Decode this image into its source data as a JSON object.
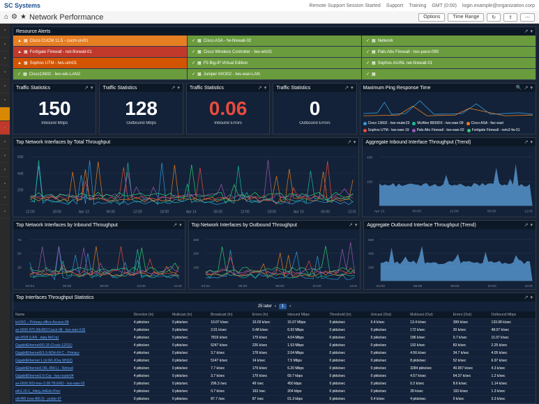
{
  "brand": "SC Systems",
  "topbar": {
    "items": [
      "Remote Support Session Started",
      "Support",
      "Training",
      "GMT (0:00)",
      "login.example@organization.corp"
    ]
  },
  "page_title": "Network Performance",
  "subbar_controls": [
    "Options",
    "Time Range"
  ],
  "sidebar": {
    "count": 14
  },
  "alerts": {
    "title": "Resource Alerts",
    "cells": [
      {
        "cls": "orange",
        "txt": "Cisco CUCM 11.5 - cucm-srv01"
      },
      {
        "cls": "green",
        "txt": "Cisco ASA - fw-firewall-02"
      },
      {
        "cls": "green",
        "txt": "Network"
      },
      {
        "cls": "red",
        "txt": "Fortigate Firewall - net-firewall-01"
      },
      {
        "cls": "green",
        "txt": "Cisco Wireless Controller - lws-wlc01"
      },
      {
        "cls": "green",
        "txt": "Palo Alto Firewall - lws-pano-090"
      },
      {
        "cls": "lightred",
        "txt": "Sophos UTM - lws-utm01"
      },
      {
        "cls": "green",
        "txt": "F5 Big-IP Virtual Edition"
      },
      {
        "cls": "green",
        "txt": "Sophos AU/NL net-firewall-01"
      },
      {
        "cls": "green",
        "txt": "Cisco13602 - lws-wlc-LAN2"
      },
      {
        "cls": "green",
        "txt": "Juniper MX302 - lws-wan-LAN"
      },
      {
        "cls": "green",
        "txt": ""
      }
    ]
  },
  "stats": [
    {
      "title": "Traffic Statistics",
      "value": "150",
      "label": "Inbound Mbps"
    },
    {
      "title": "Traffic Statistics",
      "value": "128",
      "label": "Outbound Mbps"
    },
    {
      "title": "Traffic Statistics",
      "value": "0.06",
      "label": "Inbound Errors",
      "red": true
    },
    {
      "title": "Traffic Statistics",
      "value": "0",
      "label": "Outbound Errors"
    }
  ],
  "charts": {
    "ping": {
      "title": "Maximum Ping Response Time",
      "legend": [
        "Cisco 13602 - lws-router23",
        "McAfee 8500DX - lws-wan-09",
        "Cisco ASA - fwc-east",
        "Sophos UTM - lws-wan-19",
        "Palo Alto Firewall - lws-wan-02",
        "Fortigate Firewall - netv2-fw-01"
      ]
    },
    "top_throughput": {
      "title": "Top Network Interfaces by Total Throughput",
      "ylabels": [
        "600",
        "400",
        "200"
      ],
      "xlabels": [
        "12:00",
        "18:00",
        "Apr 13",
        "06:00",
        "12:00",
        "18:00",
        "Apr 14",
        "06:00",
        "12:00",
        "18:00",
        "Apr 15",
        "06:00",
        "12:00"
      ]
    },
    "inbound": {
      "title": "Top Network Interfaces by Inbound Throughput",
      "ylabels": [
        "75",
        "50",
        "25"
      ],
      "xlabels": [
        "04:04",
        "06:00",
        "08:00",
        "10:00",
        "12:00"
      ]
    },
    "outbound": {
      "title": "Top Network Interfaces by Outbound Throughput",
      "ylabels": [
        "300",
        "200",
        "100"
      ],
      "xlabels": [
        "04:04",
        "06:00",
        "08:00",
        "10:00",
        "12:00"
      ]
    },
    "agg_in": {
      "title": "Aggregate Inbound Interface Throughput (Trend)",
      "ylabels": [
        "400",
        "200"
      ],
      "xlabels": [
        "Apr 13",
        "00:00",
        "12:00",
        "00:00",
        "12:00"
      ]
    },
    "agg_out": {
      "title": "Aggregate Outbound Interface Throughput (Trend)",
      "ylabels": [
        "600",
        "400",
        "200"
      ],
      "xlabels": [
        "04:00",
        "06:00",
        "08:00",
        "10:00",
        "12:00"
      ]
    }
  },
  "table": {
    "title": "Top Interfaces Throughput Statistics",
    "pager": {
      "info": "25 later",
      "page": "1"
    },
    "headers": [
      "Name",
      "Direction (In)",
      "Multicast (In)",
      "Broadcast (In)",
      "Errors (In)",
      "Inbound Mbps",
      "Threshold (In)",
      "Unicast (Out)",
      "Multicast (Out)",
      "Errors (Out)",
      "Outbound Mbps"
    ],
    "rows": [
      [
        "te1/0/1 – Primary-office-Access-08",
        "4 pkts/sec",
        "0 pkts/sec",
        "10.07 k/sec",
        "10.03 k/sec",
        "15.07 Mbps",
        "0 pkts/sec",
        "0.4 k/sec",
        "13.4 k/sec",
        "399 k/sec",
        "133.08 k/sec"
      ],
      [
        "xe-0/0/0.470 (Mc083:Crack-08 - lws-wan-0.8)",
        "4 pkts/sec",
        "0 pkts/sec",
        "2.01 k/sec",
        "0.48 k/sec",
        "6.92 Mbps",
        "0 pkts/sec",
        "0 pkts/sec",
        "172 k/sec",
        "20 k/sec",
        "48.07 k/sec"
      ],
      [
        "ge-0/0/8 (LAN - data.MrCrp)",
        "4 pkts/sec",
        "0 pkts/sec",
        "7819 k/sec",
        "179 k/sec",
        "4.04 Mbps",
        "0 pkts/sec",
        "0 pkts/sec",
        "186 k/sec",
        "0.7 k/sec",
        "11.07 k/sec"
      ],
      [
        "GigabitEthernet0/0.18 (Crack-12011)",
        "4 pkts/sec",
        "0 pkts/sec",
        "5247 k/sec",
        "226 k/sec",
        "1.53 Mbps",
        "0 pkts/sec",
        "0 pkts/sec",
        "192 k/sec",
        "83 k/sec",
        "2.25 k/sec"
      ],
      [
        "GigabitEthernet0/1-5-ND4-04 C - Primary",
        "4 pkts/sec",
        "0 pkts/sec",
        "3.7 k/sec",
        "178 k/sec",
        "2.04 Mbps",
        "0 pkts/sec",
        "0 pkts/sec",
        "4.56 k/sec",
        "34.7 k/sec",
        "4.05 k/sec"
      ],
      [
        "GigabitEthernet 1 (xl.WLJOra.SHQ2)",
        "4 pkts/sec",
        "0 pkts/sec",
        "5147 k/sec",
        "14 k/sec",
        "7.5 Mbps",
        "0 pkts/sec",
        "0 pkts/sec",
        "8 pkts/sec",
        "52 k/sec",
        "6.97 k/sec"
      ],
      [
        "GigabitEthernet3 (RL-RW.L) - Netvad",
        "4 pkts/sec",
        "0 pkts/sec",
        "7.7 k/sec",
        "179 k/sec",
        "6.20 Mbps",
        "0 pkts/sec",
        "0 pkts/sec",
        "3284 pkts/sec",
        "40.957 k/sec",
        "4.3 k/sec"
      ],
      [
        "GigabitEthernet1-5-Crp - lws-router04",
        "4 pkts/sec",
        "0 pkts/sec",
        "3.7 k/sec",
        "179 k/sec",
        "69.7 kbps",
        "0 pkts/sec",
        "0 pkts/sec",
        "4.57 k/sec",
        "64.37 k/sec",
        "1.2 k/sec"
      ],
      [
        "se-0/0/0.503-msv-2.08 TB.ERD - lws-wan-03",
        "0 pkts/sec",
        "0 pkts/sec",
        "296.3 /sec",
        "49 /sec",
        "450 kbps",
        "0 pkts/sec",
        "0 pkts/sec",
        "0.2 k/sec",
        "8.6 k/sec",
        "1.14 k/sec"
      ],
      [
        "eth1.15.C_Inbrg.JetEdn.Prev",
        "4 pkts/sec",
        "0 pkts/sec",
        "0.7 k/sec",
        "163 /sec",
        "204 kbps",
        "0 pkts/sec",
        "0 pkts/sec",
        "28 k/sec",
        "193 k/sec",
        "1.3 k/sec"
      ],
      [
        "eth489 (row.486.0) - probe-07",
        "0 pkts/sec",
        "0 pkts/sec",
        "87.7 /sec",
        "87 /sec",
        "01.3 kbps",
        "0 pkts/sec",
        "0.4 k/sec",
        "4 pkts/sec",
        "0 k/sec",
        "3.3 k/sec"
      ]
    ]
  },
  "colors": {
    "blue": "#3498db",
    "cyan": "#1abc9c",
    "orange": "#e67e22",
    "red": "#e74c3c",
    "purple": "#9b59b6",
    "yellow": "#f1c40f",
    "green": "#2ecc71",
    "area": "#5a9bd5"
  },
  "chart_data": {
    "type": "dashboard",
    "stats": [
      {
        "name": "Inbound Mbps",
        "value": 150
      },
      {
        "name": "Outbound Mbps",
        "value": 128
      },
      {
        "name": "Inbound Errors",
        "value": 0.06
      },
      {
        "name": "Outbound Errors",
        "value": 0
      }
    ],
    "top_throughput": {
      "type": "line",
      "ylim": [
        0,
        600
      ],
      "x_range": "Apr 12 12:00 – Apr 15 12:00",
      "series_count": 6,
      "note": "sparse spikes, peaks ~500"
    },
    "agg_inbound": {
      "type": "area",
      "ylim": [
        0,
        450
      ],
      "baseline_approx": 150,
      "peaks_approx": 400
    },
    "agg_outbound": {
      "type": "area",
      "ylim": [
        0,
        600
      ],
      "baseline_approx": 200,
      "peaks_approx": 550
    },
    "inbound_ifaces": {
      "type": "line",
      "ylim": [
        0,
        75
      ],
      "series_count": 6
    },
    "outbound_ifaces": {
      "type": "line",
      "ylim": [
        0,
        300
      ],
      "series_count": 6
    }
  }
}
